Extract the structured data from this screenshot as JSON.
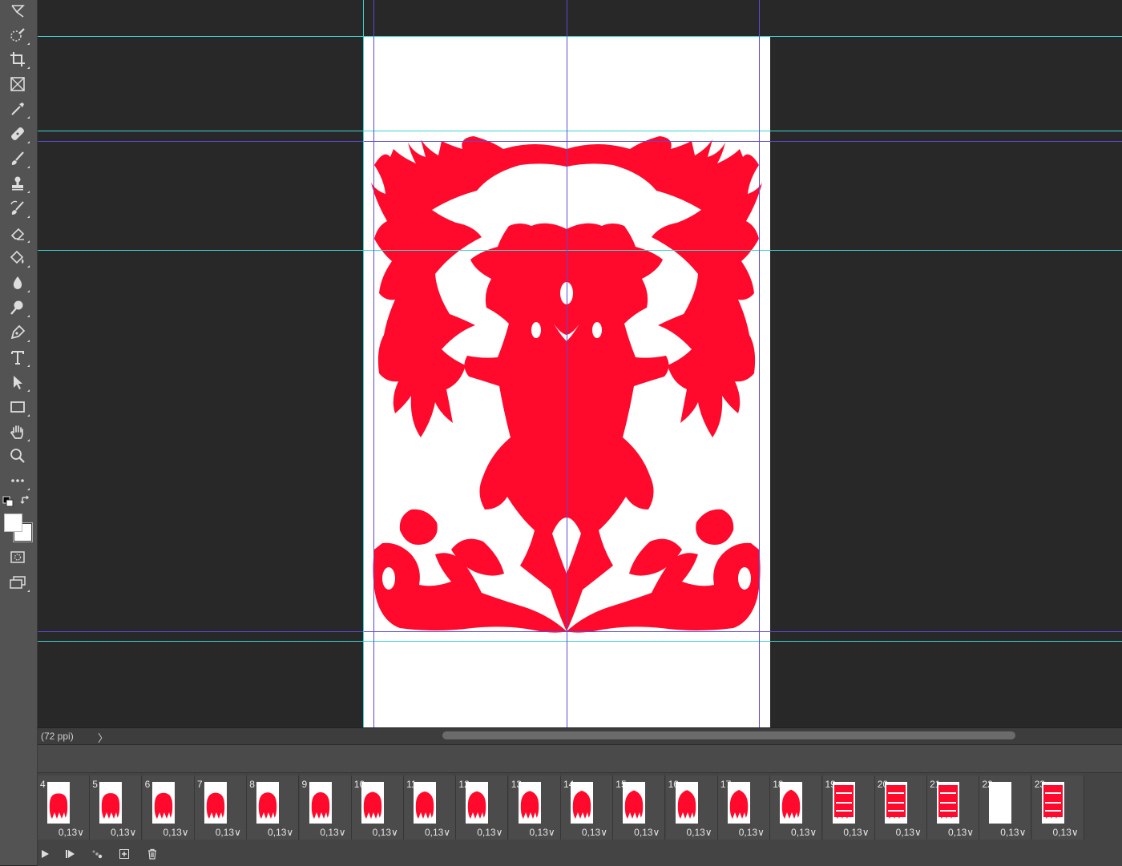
{
  "status": {
    "zoom_text": "(72 ppi)",
    "arrow": "〉"
  },
  "colors": {
    "ink_red": "#ff0a2c",
    "guide_cyan": "#3fd3d0",
    "guide_purple": "#5a4ad6"
  },
  "tools": [
    {
      "name": "lasso-icon"
    },
    {
      "name": "quick-selection-icon"
    },
    {
      "name": "crop-icon"
    },
    {
      "name": "frame-icon"
    },
    {
      "name": "eyedropper-icon"
    },
    {
      "name": "healing-brush-icon"
    },
    {
      "name": "brush-icon"
    },
    {
      "name": "clone-stamp-icon"
    },
    {
      "name": "history-brush-icon"
    },
    {
      "name": "eraser-icon"
    },
    {
      "name": "paint-bucket-icon"
    },
    {
      "name": "blur-icon"
    },
    {
      "name": "dodge-icon"
    },
    {
      "name": "pen-icon"
    },
    {
      "name": "type-icon"
    },
    {
      "name": "path-selection-icon"
    },
    {
      "name": "rectangle-icon"
    },
    {
      "name": "hand-icon"
    },
    {
      "name": "zoom-icon"
    },
    {
      "name": "more-tools-icon"
    }
  ],
  "timeline": {
    "frames": [
      {
        "num": "4",
        "delay": "0,13∨"
      },
      {
        "num": "5",
        "delay": "0,13∨"
      },
      {
        "num": "6",
        "delay": "0,13∨"
      },
      {
        "num": "7",
        "delay": "0,13∨"
      },
      {
        "num": "8",
        "delay": "0,13∨"
      },
      {
        "num": "9",
        "delay": "0,13∨"
      },
      {
        "num": "10",
        "delay": "0,13∨"
      },
      {
        "num": "11",
        "delay": "0,13∨"
      },
      {
        "num": "12",
        "delay": "0,13∨"
      },
      {
        "num": "13",
        "delay": "0,13∨"
      },
      {
        "num": "14",
        "delay": "0,13∨"
      },
      {
        "num": "15",
        "delay": "0,13∨"
      },
      {
        "num": "16",
        "delay": "0,13∨"
      },
      {
        "num": "17",
        "delay": "0,13∨"
      },
      {
        "num": "18",
        "delay": "0,13∨"
      },
      {
        "num": "19",
        "delay": "0,13∨"
      },
      {
        "num": "20",
        "delay": "0,13∨"
      },
      {
        "num": "21",
        "delay": "0,13∨"
      },
      {
        "num": "22",
        "delay": "0,13∨"
      },
      {
        "num": "23",
        "delay": "0,13∨"
      }
    ],
    "controls": [
      {
        "name": "play-icon"
      },
      {
        "name": "next-frame-icon"
      },
      {
        "name": "tween-icon"
      },
      {
        "name": "new-frame-icon"
      },
      {
        "name": "delete-frame-icon"
      }
    ]
  }
}
